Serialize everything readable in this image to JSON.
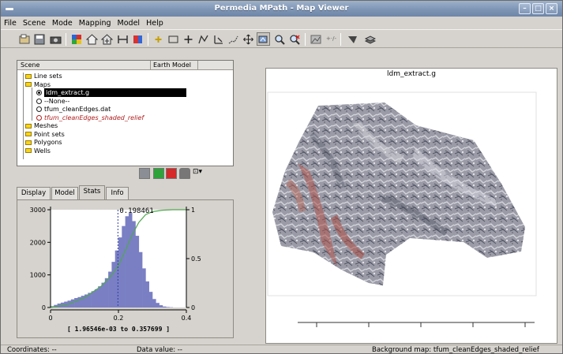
{
  "window": {
    "title": "Permedia MPath - Map Viewer"
  },
  "menu": [
    "File",
    "Scene",
    "Mode",
    "Mapping",
    "Model",
    "Help"
  ],
  "tree": {
    "headers": [
      "Scene",
      "Earth Model"
    ],
    "rows": [
      {
        "label": "Line sets",
        "kind": "folder",
        "level": 0
      },
      {
        "label": "Maps",
        "kind": "folder",
        "level": 0
      },
      {
        "label": "ldm_extract.g",
        "kind": "radio-selected",
        "level": 1
      },
      {
        "label": "--None--",
        "kind": "radio",
        "level": 1
      },
      {
        "label": "tfum_cleanEdges.dat",
        "kind": "radio",
        "level": 1
      },
      {
        "label": "tfum_cleanEdges_shaded_relief",
        "kind": "radio-red",
        "level": 1
      },
      {
        "label": "Meshes",
        "kind": "folder",
        "level": 0
      },
      {
        "label": "Point sets",
        "kind": "folder",
        "level": 0
      },
      {
        "label": "Polygons",
        "kind": "folder",
        "level": 0
      },
      {
        "label": "Wells",
        "kind": "folder",
        "level": 0
      }
    ]
  },
  "tabs": [
    "Display",
    "Model",
    "Stats",
    "Info"
  ],
  "histogram": {
    "marker_label": "0.198461",
    "range_label": "[ 1.96546e-03 to 0.357699 ]",
    "colors": {
      "bar": "#7a7fc4",
      "curve": "#4fa84f",
      "marker": "#2f3fa8"
    }
  },
  "chart_data": {
    "type": "bar",
    "title": "",
    "xlabel": "",
    "ylabel": "",
    "xlim": [
      0,
      0.4
    ],
    "ylim": [
      0,
      3000
    ],
    "y2lim": [
      0,
      1
    ],
    "x_ticks": [
      "0",
      "0.2",
      "0.4"
    ],
    "y_ticks": [
      "0",
      "1000",
      "2000",
      "3000"
    ],
    "y2_ticks": [
      "0",
      "0.5",
      "1"
    ],
    "marker_x": 0.198461,
    "bins": {
      "x": [
        0.005,
        0.015,
        0.025,
        0.035,
        0.045,
        0.055,
        0.065,
        0.075,
        0.085,
        0.095,
        0.105,
        0.115,
        0.125,
        0.135,
        0.145,
        0.155,
        0.165,
        0.175,
        0.185,
        0.195,
        0.205,
        0.215,
        0.225,
        0.235,
        0.245,
        0.255,
        0.265,
        0.275,
        0.285,
        0.295,
        0.305,
        0.315,
        0.325,
        0.335,
        0.345,
        0.355
      ],
      "values": [
        40,
        80,
        120,
        150,
        180,
        210,
        250,
        290,
        320,
        360,
        400,
        450,
        500,
        560,
        650,
        760,
        900,
        1100,
        1400,
        1750,
        2150,
        2500,
        2800,
        2900,
        2650,
        2200,
        1700,
        1200,
        800,
        480,
        260,
        140,
        70,
        30,
        15,
        8
      ]
    },
    "cumulative_curve": {
      "x": [
        0,
        0.05,
        0.1,
        0.15,
        0.18,
        0.2,
        0.22,
        0.24,
        0.26,
        0.28,
        0.3,
        0.33,
        0.36,
        0.4
      ],
      "values": [
        0,
        0.03,
        0.1,
        0.22,
        0.33,
        0.43,
        0.58,
        0.74,
        0.87,
        0.95,
        0.98,
        0.995,
        1,
        1
      ]
    }
  },
  "viewer": {
    "title": "ldm_extract.g"
  },
  "status": {
    "coordinates": "Coordinates: --",
    "data_value": "Data value: --",
    "background": "Background map: tfum_cleanEdges_shaded_relief"
  },
  "icons": [
    "open-icon",
    "save-icon",
    "camera-icon",
    "earth-model-icon",
    "house-icon",
    "mesh-icon",
    "grid-icon",
    "cube-icon",
    "point-icon",
    "rect-icon",
    "plus-icon",
    "polyline-icon",
    "well-icon",
    "path-icon",
    "move-icon",
    "select-map-icon",
    "zoom-in-icon",
    "zoom-clear-icon",
    "profile-icon",
    "trace-icon",
    "flag-icon",
    "layers-icon"
  ]
}
